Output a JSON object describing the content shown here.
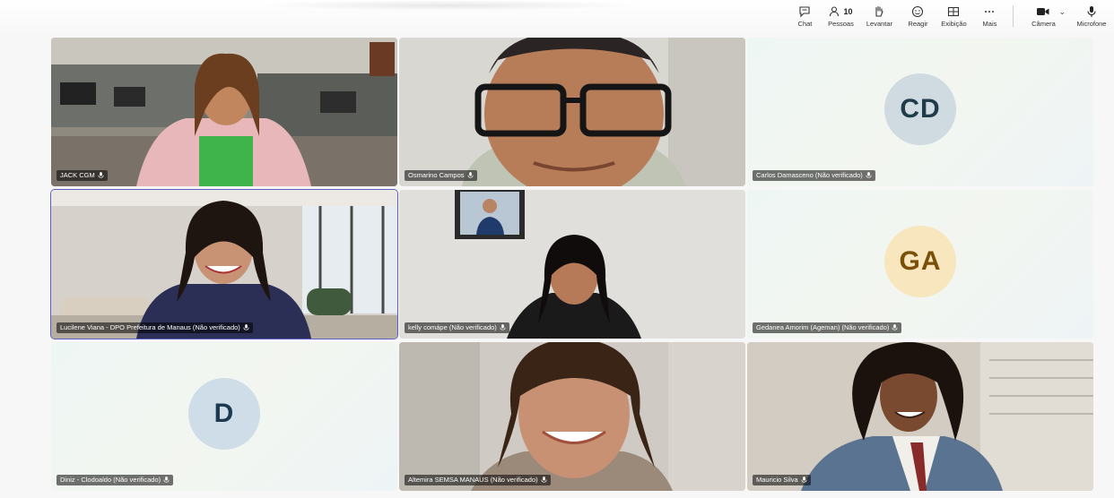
{
  "toolbar": {
    "chat": {
      "label": "Chat",
      "icon": "chat-icon"
    },
    "people": {
      "label": "Pessoas",
      "count": "10",
      "icon": "people-icon"
    },
    "raise": {
      "label": "Levantar",
      "icon": "raise-hand-icon"
    },
    "react": {
      "label": "Reagir",
      "icon": "react-icon"
    },
    "view": {
      "label": "Exibição",
      "icon": "view-icon"
    },
    "more": {
      "label": "Mais",
      "icon": "more-icon"
    },
    "camera": {
      "label": "Câmera",
      "icon": "camera-icon"
    },
    "mic": {
      "label": "Microfone",
      "icon": "microphone-icon"
    }
  },
  "participants": [
    {
      "name": "JACK CGM",
      "type": "video",
      "scene": "office-woman-pink"
    },
    {
      "name": "Osmarino Campos",
      "type": "video",
      "scene": "man-glasses-closeup"
    },
    {
      "name": "Carlos Damasceno (Não verificado)",
      "type": "avatar",
      "initials": "CD",
      "avatar_bg": "#cfdbe0",
      "avatar_fg": "#1f3c48"
    },
    {
      "name": "Lucilene Viana - DPO Prefeitura de Manaus (Não verificado)",
      "type": "video",
      "scene": "woman-living-room",
      "selected": true
    },
    {
      "name": "kelly comápe (Não verificado)",
      "type": "video",
      "scene": "woman-dark-hair-frame"
    },
    {
      "name": "Gedanea Amorim (Ageman) (Não verificado)",
      "type": "avatar",
      "initials": "GA",
      "avatar_bg": "#f8e6be",
      "avatar_fg": "#7a4f08"
    },
    {
      "name": "Diniz - Clodoaldo (Não verificado)",
      "type": "avatar",
      "initials": "D",
      "avatar_bg": "#cfdde8",
      "avatar_fg": "#1b3a52"
    },
    {
      "name": "Altemira SEMSA MANAUS (Não verificado)",
      "type": "video",
      "scene": "woman-smiling-closeup"
    },
    {
      "name": "Mauricio Silva",
      "type": "video",
      "scene": "man-curly-hair-suit"
    }
  ]
}
